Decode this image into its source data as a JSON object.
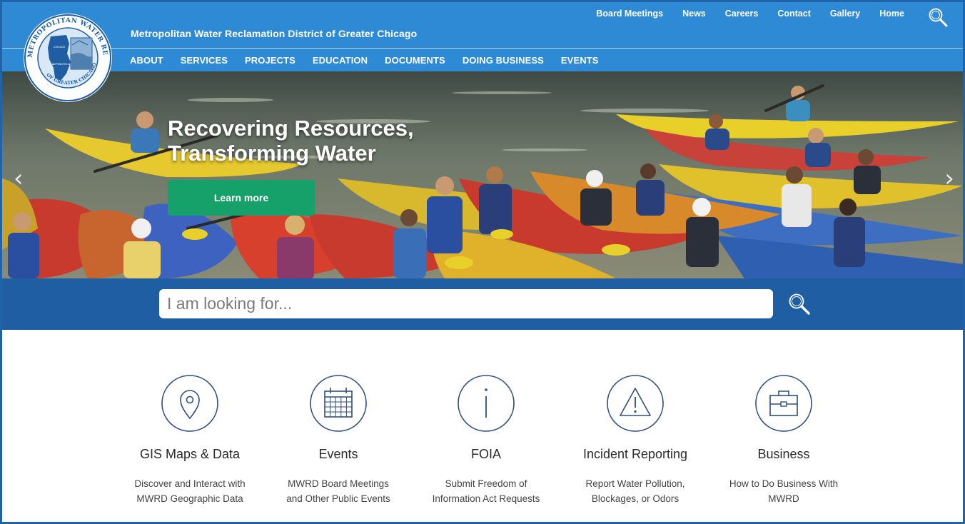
{
  "header": {
    "site_title": "Metropolitan Water Reclamation District of Greater Chicago",
    "util_nav": [
      "Board Meetings",
      "News",
      "Careers",
      "Contact",
      "Gallery",
      "Home"
    ],
    "main_nav": [
      "ABOUT",
      "SERVICES",
      "PROJECTS",
      "EDUCATION",
      "DOCUMENTS",
      "DOING BUSINESS",
      "EVENTS"
    ],
    "logo": {
      "ring_text_top": "METROPOLITAN WATER RECLAMATION DISTRICT",
      "ring_text_bottom": "OF GREATER CHICAGO",
      "map_label_1": "CHICAGO",
      "map_label_2": "SPRINGFIELD"
    },
    "search_icon": "magnifier-icon"
  },
  "hero": {
    "title_line1": "Recovering Resources,",
    "title_line2": "Transforming Water",
    "button_label": "Learn more",
    "prev_arrow": "‹",
    "next_arrow": "›"
  },
  "search": {
    "placeholder": "I am looking for..."
  },
  "features": [
    {
      "icon": "map-pin-icon",
      "title": "GIS Maps & Data",
      "desc_line1": "Discover and Interact with",
      "desc_line2": "MWRD Geographic Data"
    },
    {
      "icon": "calendar-icon",
      "title": "Events",
      "desc_line1": "MWRD Board Meetings",
      "desc_line2": "and Other Public Events"
    },
    {
      "icon": "info-icon",
      "title": "FOIA",
      "desc_line1": "Submit Freedom of",
      "desc_line2": "Information Act Requests"
    },
    {
      "icon": "warning-icon",
      "title": "Incident Reporting",
      "desc_line1": "Report Water Pollution,",
      "desc_line2": "Blockages, or Odors"
    },
    {
      "icon": "briefcase-icon",
      "title": "Business",
      "desc_line1": "How to Do Business With",
      "desc_line2": "MWRD"
    }
  ],
  "colors": {
    "header_blue": "#2f8ad6",
    "search_band_blue": "#1f5ea2",
    "button_green": "#16a06a",
    "icon_stroke": "#2e4f7a"
  }
}
